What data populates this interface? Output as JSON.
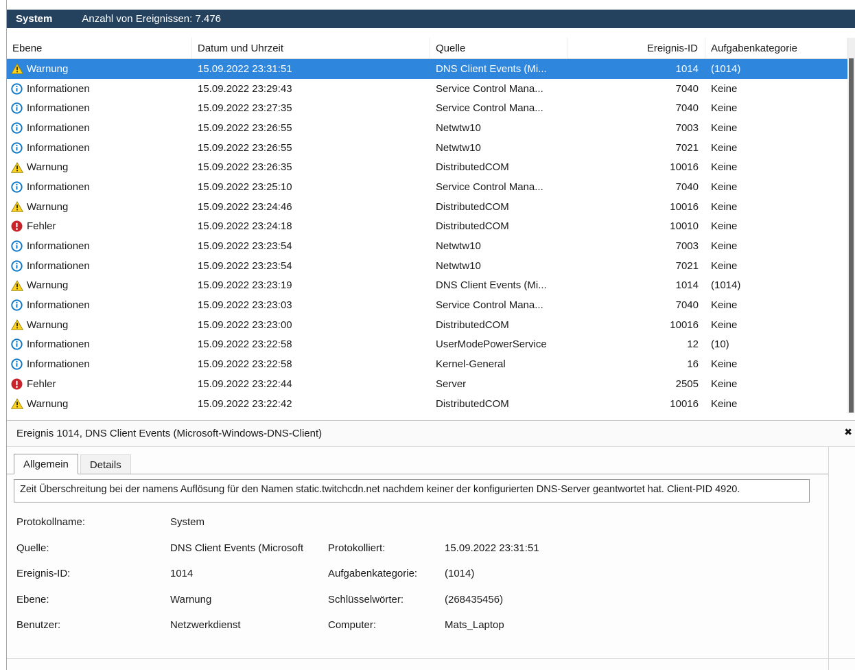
{
  "header": {
    "title": "System",
    "subtitle": "Anzahl von Ereignissen: 7.476"
  },
  "icons": {
    "close": "✖"
  },
  "colors": {
    "header_bar": "#24415e",
    "selection": "#2f86dd",
    "info_blue": "#0b76c6",
    "warning_yellow": "#ffd21c",
    "error_red": "#c9242b"
  },
  "table": {
    "columns": {
      "level": "Ebene",
      "datetime": "Datum und Uhrzeit",
      "source": "Quelle",
      "event_id": "Ereignis-ID",
      "category": "Aufgabenkategorie"
    },
    "rows": [
      {
        "icon": "warning",
        "level": "Warnung",
        "datetime": "15.09.2022 23:31:51",
        "source": "DNS Client Events (Mi...",
        "event_id": "1014",
        "category": "(1014)",
        "selected": true
      },
      {
        "icon": "information",
        "level": "Informationen",
        "datetime": "15.09.2022 23:29:43",
        "source": "Service Control Mana...",
        "event_id": "7040",
        "category": "Keine",
        "selected": false
      },
      {
        "icon": "information",
        "level": "Informationen",
        "datetime": "15.09.2022 23:27:35",
        "source": "Service Control Mana...",
        "event_id": "7040",
        "category": "Keine",
        "selected": false
      },
      {
        "icon": "information",
        "level": "Informationen",
        "datetime": "15.09.2022 23:26:55",
        "source": "Netwtw10",
        "event_id": "7003",
        "category": "Keine",
        "selected": false
      },
      {
        "icon": "information",
        "level": "Informationen",
        "datetime": "15.09.2022 23:26:55",
        "source": "Netwtw10",
        "event_id": "7021",
        "category": "Keine",
        "selected": false
      },
      {
        "icon": "warning",
        "level": "Warnung",
        "datetime": "15.09.2022 23:26:35",
        "source": "DistributedCOM",
        "event_id": "10016",
        "category": "Keine",
        "selected": false
      },
      {
        "icon": "information",
        "level": "Informationen",
        "datetime": "15.09.2022 23:25:10",
        "source": "Service Control Mana...",
        "event_id": "7040",
        "category": "Keine",
        "selected": false
      },
      {
        "icon": "warning",
        "level": "Warnung",
        "datetime": "15.09.2022 23:24:46",
        "source": "DistributedCOM",
        "event_id": "10016",
        "category": "Keine",
        "selected": false
      },
      {
        "icon": "error",
        "level": "Fehler",
        "datetime": "15.09.2022 23:24:18",
        "source": "DistributedCOM",
        "event_id": "10010",
        "category": "Keine",
        "selected": false
      },
      {
        "icon": "information",
        "level": "Informationen",
        "datetime": "15.09.2022 23:23:54",
        "source": "Netwtw10",
        "event_id": "7003",
        "category": "Keine",
        "selected": false
      },
      {
        "icon": "information",
        "level": "Informationen",
        "datetime": "15.09.2022 23:23:54",
        "source": "Netwtw10",
        "event_id": "7021",
        "category": "Keine",
        "selected": false
      },
      {
        "icon": "warning",
        "level": "Warnung",
        "datetime": "15.09.2022 23:23:19",
        "source": "DNS Client Events (Mi...",
        "event_id": "1014",
        "category": "(1014)",
        "selected": false
      },
      {
        "icon": "information",
        "level": "Informationen",
        "datetime": "15.09.2022 23:23:03",
        "source": "Service Control Mana...",
        "event_id": "7040",
        "category": "Keine",
        "selected": false
      },
      {
        "icon": "warning",
        "level": "Warnung",
        "datetime": "15.09.2022 23:23:00",
        "source": "DistributedCOM",
        "event_id": "10016",
        "category": "Keine",
        "selected": false
      },
      {
        "icon": "information",
        "level": "Informationen",
        "datetime": "15.09.2022 23:22:58",
        "source": "UserModePowerService",
        "event_id": "12",
        "category": "(10)",
        "selected": false
      },
      {
        "icon": "information",
        "level": "Informationen",
        "datetime": "15.09.2022 23:22:58",
        "source": "Kernel-General",
        "event_id": "16",
        "category": "Keine",
        "selected": false
      },
      {
        "icon": "error",
        "level": "Fehler",
        "datetime": "15.09.2022 23:22:44",
        "source": "Server",
        "event_id": "2505",
        "category": "Keine",
        "selected": false
      },
      {
        "icon": "warning",
        "level": "Warnung",
        "datetime": "15.09.2022 23:22:42",
        "source": "DistributedCOM",
        "event_id": "10016",
        "category": "Keine",
        "selected": false
      }
    ]
  },
  "details": {
    "title": "Ereignis 1014, DNS Client Events (Microsoft-Windows-DNS-Client)",
    "tabs": [
      {
        "label": "Allgemein",
        "active": true
      },
      {
        "label": "Details",
        "active": false
      }
    ],
    "message": "Zeit Überschreitung bei der namens Auflösung für den Namen static.twitchcdn.net nachdem keiner der konfigurierten DNS-Server geantwortet hat. Client-PID 4920.",
    "fields": [
      {
        "label": "Protokollname:",
        "value": "System",
        "label2": "",
        "value2": ""
      },
      {
        "label": "Quelle:",
        "value": "DNS Client Events (Microsoft",
        "label2": "Protokolliert:",
        "value2": "15.09.2022 23:31:51"
      },
      {
        "label": "Ereignis-ID:",
        "value": "1014",
        "label2": "Aufgabenkategorie:",
        "value2": "(1014)"
      },
      {
        "label": "Ebene:",
        "value": "Warnung",
        "label2": "Schlüsselwörter:",
        "value2": "(268435456)"
      },
      {
        "label": "Benutzer:",
        "value": "Netzwerkdienst",
        "label2": "Computer:",
        "value2": "Mats_Laptop"
      }
    ]
  }
}
